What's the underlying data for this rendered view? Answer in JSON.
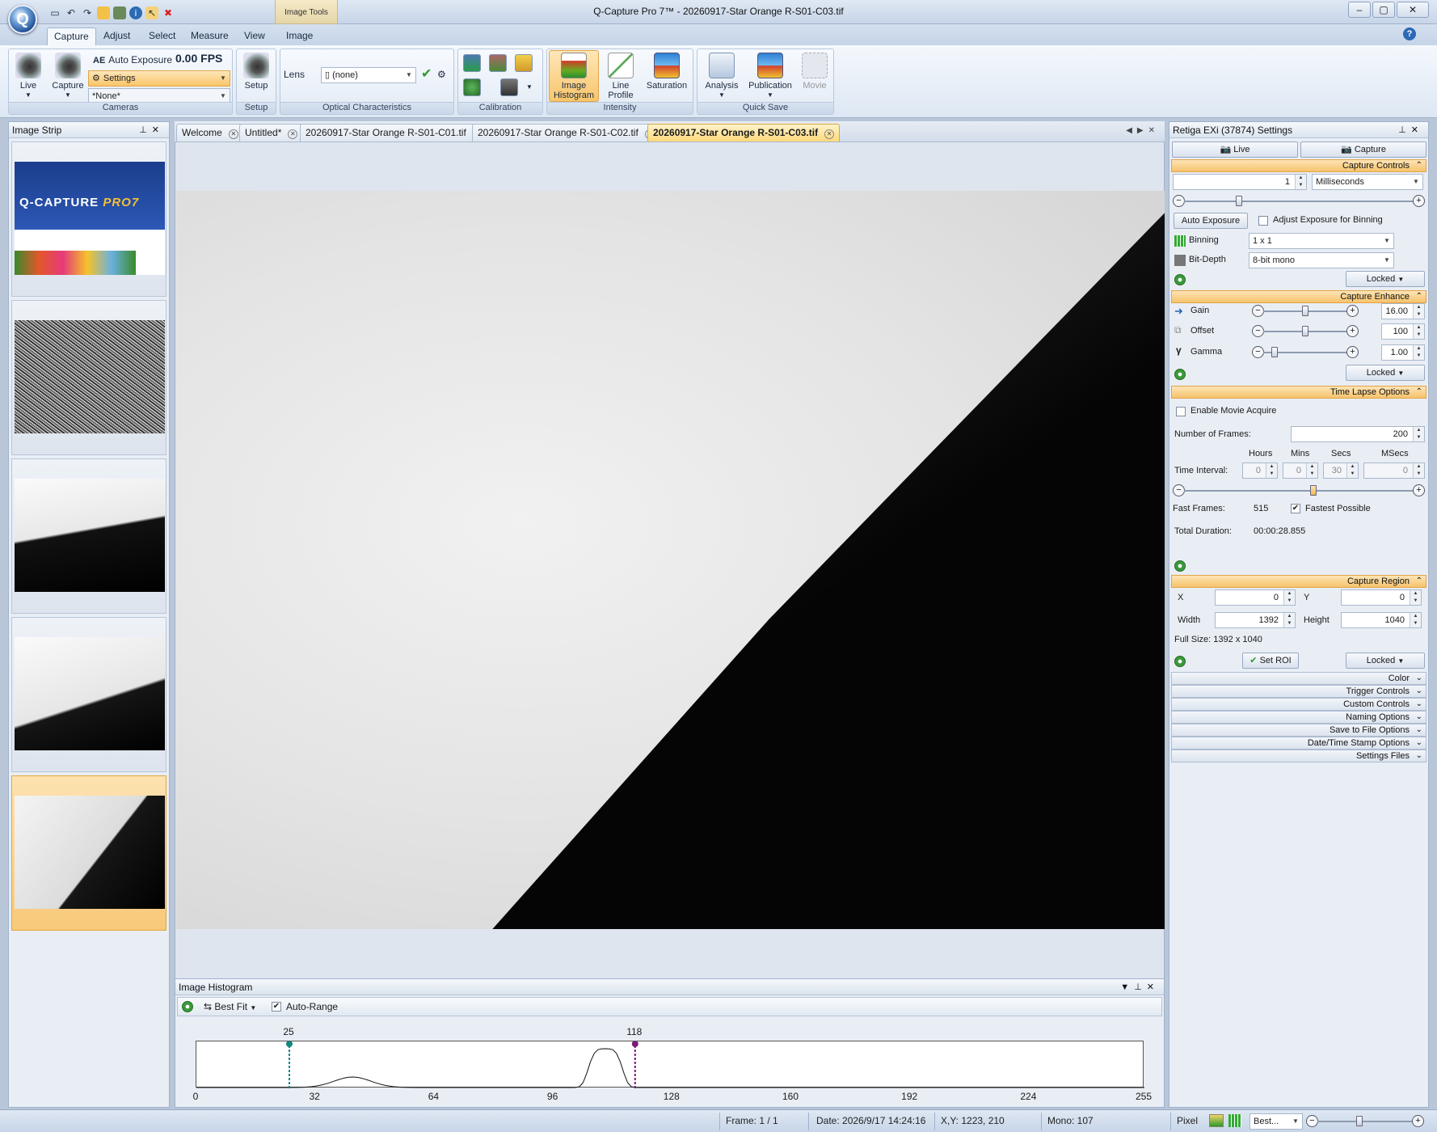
{
  "window": {
    "title": "Q-Capture Pro 7™ - 20260917-Star Orange R-S01-C03.tif",
    "context_tab": "Image Tools"
  },
  "ribbon": {
    "tabs": [
      "Capture",
      "Adjust",
      "Select",
      "Measure",
      "View",
      "Image"
    ],
    "active_tab": "Capture",
    "cameras": {
      "live": "Live",
      "capture": "Capture",
      "auto_exposure": "Auto Exposure",
      "ae_badge": "AE",
      "fps": "0.00 FPS",
      "settings": "Settings",
      "preset": "*None*",
      "label": "Cameras"
    },
    "setup": {
      "button": "Setup",
      "label": "Setup"
    },
    "optical": {
      "lens_label": "Lens",
      "lens_value": "(none)",
      "label": "Optical Characteristics"
    },
    "calibration": {
      "label": "Calibration"
    },
    "intensity": {
      "histogram": "Image Histogram",
      "line_profile": "Line Profile",
      "saturation": "Saturation",
      "label": "Intensity"
    },
    "quick_save": {
      "analysis": "Analysis",
      "publication": "Publication",
      "movie": "Movie",
      "label": "Quick Save"
    }
  },
  "image_strip": {
    "title": "Image Strip",
    "thumb1_brand": "Q-CAPTURE",
    "thumb1_brand_suffix": "PRO7"
  },
  "doc_tabs": [
    "Welcome",
    "Untitled*",
    "20260917-Star Orange R-S01-C01.tif",
    "20260917-Star Orange R-S01-C02.tif",
    "20260917-Star Orange R-S01-C03.tif"
  ],
  "active_doc_tab": 4,
  "histogram": {
    "title": "Image Histogram",
    "fit": "Best Fit",
    "auto_range": "Auto-Range",
    "auto_range_checked": true,
    "low_marker": 25,
    "high_marker": 118,
    "ticks": [
      "0",
      "32",
      "64",
      "96",
      "128",
      "160",
      "192",
      "224",
      "255"
    ],
    "colors": {
      "low": "#0f8a7e",
      "high": "#7a1a7a"
    }
  },
  "settings": {
    "title": "Retiga EXi (37874) Settings",
    "live": "Live",
    "capture": "Capture",
    "capture_controls": {
      "header": "Capture Controls",
      "exposure": "1",
      "units": "Milliseconds",
      "auto_exposure": "Auto Exposure",
      "adjust_binning": "Adjust Exposure for Binning",
      "binning_label": "Binning",
      "binning": "1 x 1",
      "bitdepth_label": "Bit-Depth",
      "bitdepth": "8-bit mono",
      "locked": "Locked"
    },
    "capture_enhance": {
      "header": "Capture Enhance",
      "gain_label": "Gain",
      "gain": "16.00",
      "offset_label": "Offset",
      "offset": "100",
      "gamma_label": "Gamma",
      "gamma": "1.00",
      "locked": "Locked"
    },
    "time_lapse": {
      "header": "Time Lapse Options",
      "enable_movie": "Enable Movie Acquire",
      "frames_label": "Number of  Frames:",
      "frames": "200",
      "hours": "Hours",
      "mins": "Mins",
      "secs": "Secs",
      "msecs": "MSecs",
      "interval_label": "Time Interval:",
      "h_val": "0",
      "m_val": "0",
      "s_val": "30",
      "ms_val": "0",
      "fast_frames_label": "Fast Frames:",
      "fast_frames": "515",
      "fastest": "Fastest Possible",
      "duration_label": "Total Duration:",
      "duration": "00:00:28.855"
    },
    "capture_region": {
      "header": "Capture Region",
      "x_label": "X",
      "x": "0",
      "y_label": "Y",
      "y": "0",
      "width_label": "Width",
      "width": "1392",
      "height_label": "Height",
      "height": "1040",
      "full_size": "Full Size: 1392 x 1040",
      "set_roi": "Set ROI",
      "locked": "Locked"
    },
    "collapsed_sections": [
      "Color",
      "Trigger Controls",
      "Custom Controls",
      "Naming Options",
      "Save to File Options",
      "Date/Time Stamp Options",
      "Settings Files"
    ]
  },
  "status": {
    "frame": "Frame: 1 / 1",
    "date": "Date: 2026/9/17 14:24:16",
    "xy": "X,Y: 1223,  210",
    "mono": "Mono:   107",
    "pixel": "Pixel",
    "zoom": "Best..."
  }
}
